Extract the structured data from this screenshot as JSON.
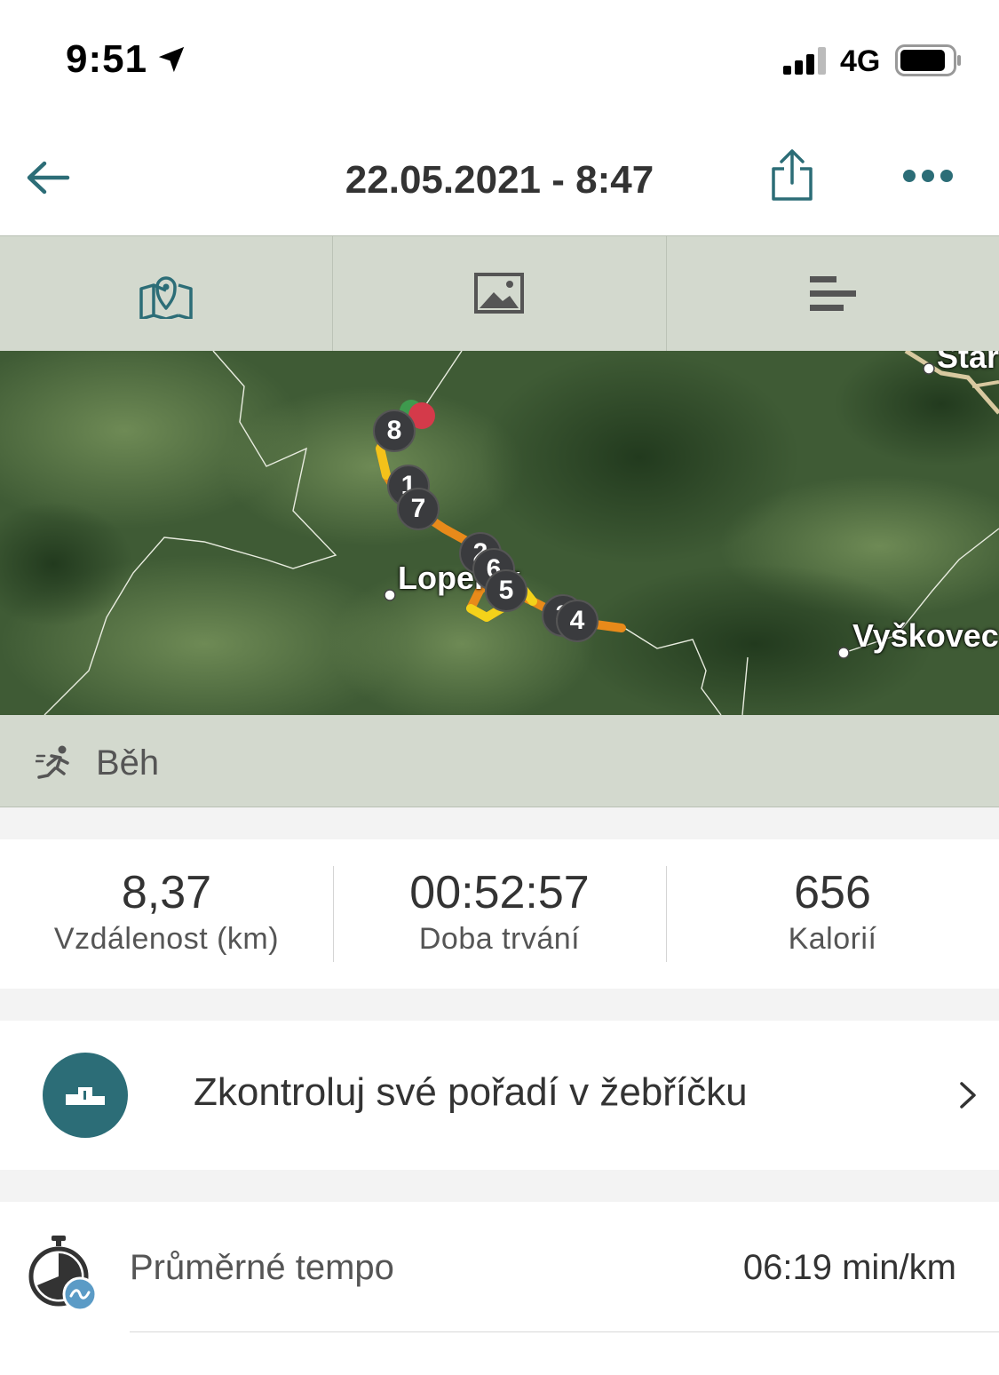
{
  "status_bar": {
    "time": "9:51",
    "network": "4G",
    "icons": [
      "location-arrow-icon",
      "signal-icon",
      "battery-icon"
    ]
  },
  "header": {
    "title": "22.05.2021 - 8:47",
    "icons": [
      "back-arrow-icon",
      "share-icon",
      "more-icon"
    ],
    "accent_color": "#2c6d77"
  },
  "tabs": [
    {
      "icon": "map-icon",
      "active": true
    },
    {
      "icon": "image-icon",
      "active": false
    },
    {
      "icon": "stats-icon",
      "active": false
    }
  ],
  "map": {
    "places": [
      "Lopeník",
      "Vyškovec",
      "Star"
    ],
    "km_markers": [
      "8",
      "1",
      "7",
      "2",
      "6",
      "5",
      "3",
      "4"
    ]
  },
  "activity": {
    "icon": "running-icon",
    "label": "Běh"
  },
  "stats": [
    {
      "value": "8,37",
      "label": "Vzdálenost (km)"
    },
    {
      "value": "00:52:57",
      "label": "Doba trvání"
    },
    {
      "value": "656",
      "label": "Kalorií"
    }
  ],
  "leaderboard": {
    "icon": "podium-icon",
    "label": "Zkontroluj své pořadí v žebříčku"
  },
  "pace": {
    "icon": "stopwatch-icon",
    "label": "Průměrné tempo",
    "value": "06:19 min/km"
  }
}
